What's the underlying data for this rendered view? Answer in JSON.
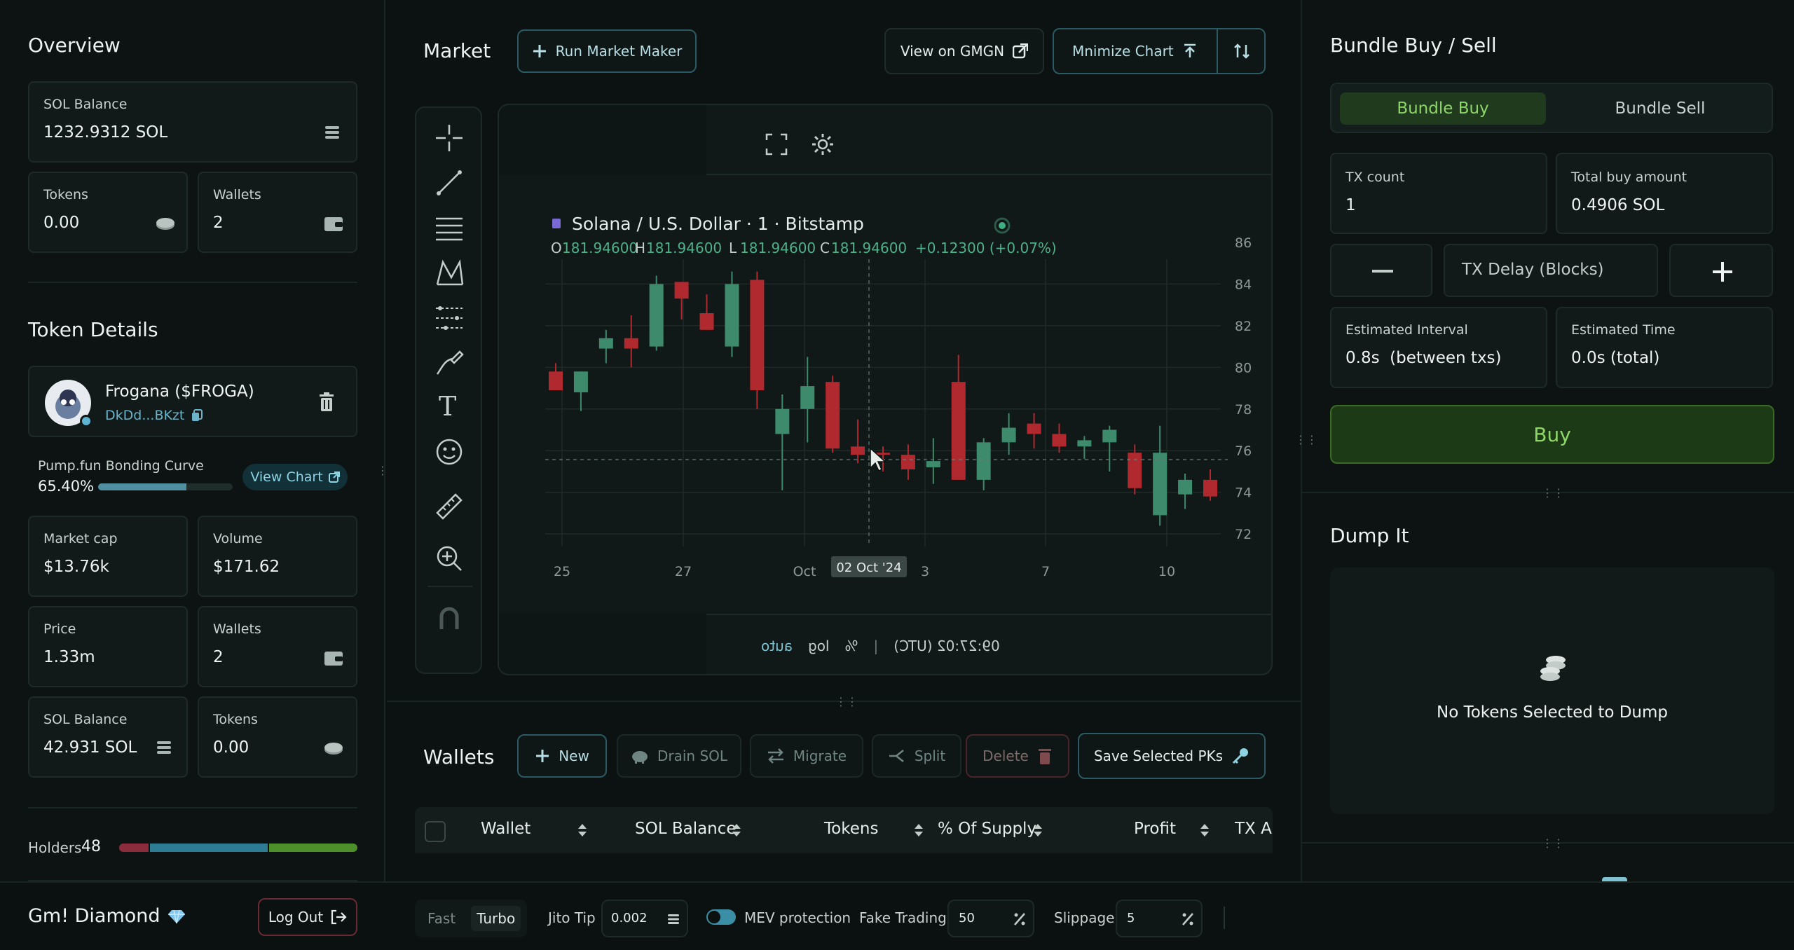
{
  "overview": {
    "title": "Overview",
    "sol_balance_label": "SOL Balance",
    "sol_balance_value": "1232.9312 SOL",
    "tokens_label": "Tokens",
    "tokens_value": "0.00",
    "wallets_label": "Wallets",
    "wallets_value": "2"
  },
  "token_details": {
    "title": "Token Details",
    "name": "Frogana ($FROGA)",
    "address": "DkDd...BKzt",
    "curve_label": "Pump.fun Bonding Curve",
    "curve_percent": "65.40%",
    "curve_fraction": 0.654,
    "view_chart_label": "View Chart",
    "market_cap_label": "Market cap",
    "market_cap_value": "$13.76k",
    "volume_label": "Volume",
    "volume_value": "$171.62",
    "price_label": "Price",
    "price_value": "1.33m",
    "wallets_label": "Wallets",
    "wallets_value": "2",
    "sol_balance_label": "SOL Balance",
    "sol_balance_value": "42.931 SOL",
    "tokens_label": "Tokens",
    "tokens_value": "0.00",
    "holders_label": "Holders",
    "holders_count": "48"
  },
  "footer_left": {
    "user_name": "Gm! Diamond",
    "logout_label": "Log Out"
  },
  "market": {
    "title": "Market",
    "run_mm_label": "Run Market Maker",
    "view_gmgn_label": "View on GMGN",
    "minimize_label": "Mnimize Chart"
  },
  "chart": {
    "legend_title": "Solana / U.S. Dollar · 1 · Bitstamp",
    "o_label": "O",
    "o_value": "181.94600",
    "h_label": "H",
    "h_value": "181.94600",
    "l_label": "L",
    "l_value": "181.94600",
    "c_label": "C",
    "c_value": "181.94600",
    "change": "+0.12300 (+0.07%)",
    "crosshair_date": "02 Oct '24",
    "footer_time": "09:27:02 (UTC)",
    "footer_log": "log",
    "footer_auto": "auto",
    "footer_pct": "%"
  },
  "chart_data": {
    "type": "candlestick",
    "x_ticks": [
      "25",
      "27",
      "Oct",
      "3",
      "7",
      "10"
    ],
    "y_ticks": [
      "86",
      "84",
      "82",
      "80",
      "78",
      "76",
      "74",
      "72"
    ],
    "ylim": [
      71.4,
      86.2
    ],
    "candles": [
      {
        "o": 79.8,
        "h": 80.2,
        "l": 78.9,
        "c": 78.9
      },
      {
        "o": 78.8,
        "h": 79.8,
        "l": 77.9,
        "c": 79.8
      },
      {
        "o": 80.9,
        "h": 81.8,
        "l": 80.2,
        "c": 81.4
      },
      {
        "o": 81.4,
        "h": 82.5,
        "l": 80.0,
        "c": 80.9
      },
      {
        "o": 81.0,
        "h": 84.4,
        "l": 80.8,
        "c": 84.0
      },
      {
        "o": 84.1,
        "h": 84.1,
        "l": 82.3,
        "c": 83.3
      },
      {
        "o": 82.6,
        "h": 83.5,
        "l": 81.8,
        "c": 81.8
      },
      {
        "o": 81.0,
        "h": 84.6,
        "l": 80.5,
        "c": 84.0
      },
      {
        "o": 84.2,
        "h": 84.6,
        "l": 78.0,
        "c": 78.9
      },
      {
        "o": 76.8,
        "h": 78.7,
        "l": 74.1,
        "c": 78.0
      },
      {
        "o": 78.0,
        "h": 80.5,
        "l": 76.4,
        "c": 79.1
      },
      {
        "o": 79.3,
        "h": 79.6,
        "l": 75.9,
        "c": 76.1
      },
      {
        "o": 76.2,
        "h": 77.5,
        "l": 75.4,
        "c": 75.8
      },
      {
        "o": 75.9,
        "h": 76.2,
        "l": 75.0,
        "c": 75.8
      },
      {
        "o": 75.8,
        "h": 76.3,
        "l": 74.6,
        "c": 75.1
      },
      {
        "o": 75.2,
        "h": 76.6,
        "l": 74.4,
        "c": 75.5
      },
      {
        "o": 79.3,
        "h": 80.6,
        "l": 75.0,
        "c": 74.6
      },
      {
        "o": 74.6,
        "h": 76.6,
        "l": 74.1,
        "c": 76.4
      },
      {
        "o": 76.4,
        "h": 77.8,
        "l": 75.8,
        "c": 77.1
      },
      {
        "o": 77.3,
        "h": 77.8,
        "l": 76.1,
        "c": 76.8
      },
      {
        "o": 76.8,
        "h": 77.3,
        "l": 75.9,
        "c": 76.2
      },
      {
        "o": 76.2,
        "h": 76.7,
        "l": 75.6,
        "c": 76.5
      },
      {
        "o": 76.4,
        "h": 77.2,
        "l": 75.0,
        "c": 77.0
      },
      {
        "o": 75.9,
        "h": 76.3,
        "l": 73.9,
        "c": 74.2
      },
      {
        "o": 72.9,
        "h": 77.2,
        "l": 72.4,
        "c": 75.9
      },
      {
        "o": 73.9,
        "h": 74.9,
        "l": 73.2,
        "c": 74.6
      },
      {
        "o": 74.6,
        "h": 75.1,
        "l": 73.6,
        "c": 73.8
      }
    ],
    "grid": true
  },
  "wallets": {
    "title": "Wallets",
    "new_label": "New",
    "drain_label": "Drain SOL",
    "migrate_label": "Migrate",
    "split_label": "Split",
    "delete_label": "Delete",
    "save_pks_label": "Save Selected PKs",
    "columns": [
      "Wallet",
      "SOL Balance",
      "Tokens",
      "% Of Supply",
      "Profit",
      "TX Ar"
    ]
  },
  "bundle": {
    "title": "Bundle Buy / Sell",
    "tab_buy": "Bundle Buy",
    "tab_sell": "Bundle Sell",
    "tx_count_label": "TX count",
    "tx_count_value": "1",
    "total_buy_label": "Total buy amount",
    "total_buy_value": "0.4906 SOL",
    "tx_delay_placeholder": "TX Delay (Blocks)",
    "est_interval_label": "Estimated Interval",
    "est_interval_value": "0.8s  (between txs)",
    "est_time_label": "Estimated Time",
    "est_time_value": "0.0s (total)",
    "buy_label": "Buy"
  },
  "dump": {
    "title": "Dump It",
    "empty_text": "No Tokens Selected to Dump"
  },
  "bottombar": {
    "fast_label": "Fast",
    "turbo_label": "Turbo",
    "jito_label": "Jito Tip",
    "jito_value": "0.002",
    "mev_label": "MEV protection",
    "fake_label": "Fake Trading",
    "fake_value": "50",
    "slippage_label": "Slippage",
    "slippage_value": "5"
  },
  "colors": {
    "bull": "#3e8a6c",
    "bear": "#b0292e",
    "accent": "#2a6d7a",
    "buy_green": "#8fd66a"
  }
}
